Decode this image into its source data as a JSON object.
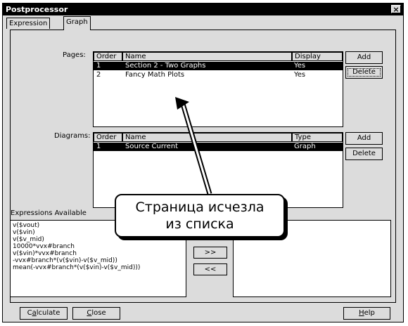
{
  "window": {
    "title": "Postprocessor",
    "close_glyph": "×"
  },
  "tabs": [
    {
      "label": "Expression",
      "active": false
    },
    {
      "label": "Graph",
      "active": true
    }
  ],
  "pages": {
    "label": "Pages:",
    "columns": [
      "Order",
      "Name",
      "Display"
    ],
    "rows": [
      {
        "order": "1",
        "name": "Section 2 - Two Graphs",
        "display": "Yes",
        "selected": true
      },
      {
        "order": "2",
        "name": "Fancy Math Plots",
        "display": "Yes",
        "selected": false
      }
    ],
    "add_label": "Add",
    "delete_label": "Delete"
  },
  "diagrams": {
    "label": "Diagrams:",
    "columns": [
      "Order",
      "Name",
      "Type"
    ],
    "rows": [
      {
        "order": "1",
        "name": "Source Current",
        "type": "Graph",
        "selected": true
      }
    ],
    "add_label": "Add",
    "delete_label": "Delete"
  },
  "expressions": {
    "label": "Expressions Available",
    "items": [
      "v($vout)",
      "v($vin)",
      "v($v_mid)",
      "10000*vvx#branch",
      "v($vin)*vvx#branch",
      "-vvx#branch*(v($vin)-v($v_mid))",
      "mean(-vvx#branch*(v($vin)-v($v_mid)))"
    ],
    "move_right_label": ">>",
    "move_left_label": "<<"
  },
  "footer": {
    "calculate_label": "Calculate",
    "close_label": "Close",
    "help_label": "Help"
  },
  "annotation": {
    "line1": "Страница исчезла",
    "line2": "из списка"
  }
}
